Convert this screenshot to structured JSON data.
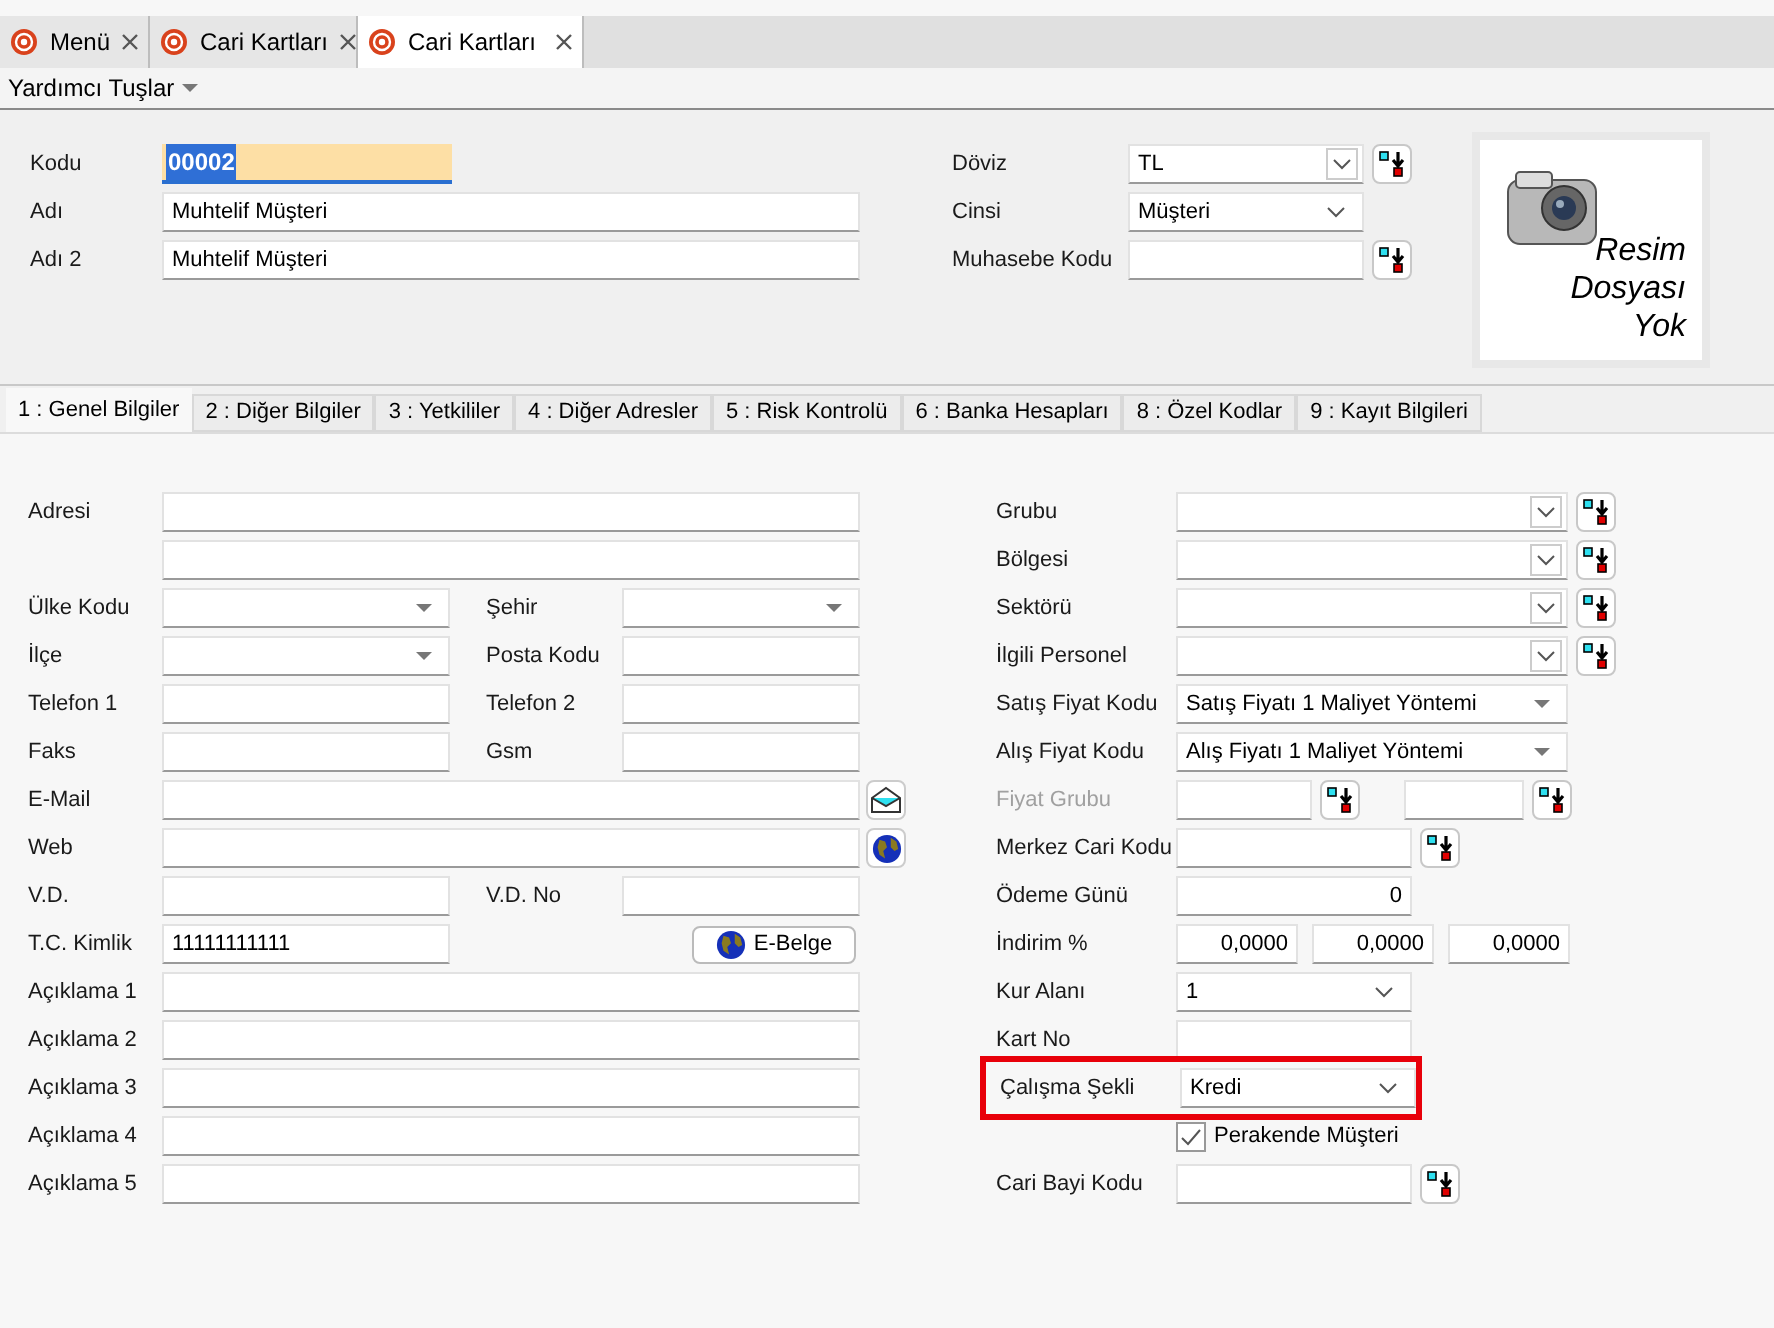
{
  "tabs": [
    {
      "label": "Menü",
      "selected": false
    },
    {
      "label": "Cari Kartları",
      "selected": false
    },
    {
      "label": "Cari Kartları",
      "selected": true
    }
  ],
  "toolbar": {
    "label": "Yardımcı Tuşlar"
  },
  "header": {
    "left": [
      {
        "label": "Kodu",
        "value": "00002",
        "kind": "code"
      },
      {
        "label": "Adı",
        "value": "Muhtelif Müşteri",
        "kind": "text"
      },
      {
        "label": "Adı 2",
        "value": "Muhtelif Müşteri",
        "kind": "text"
      }
    ],
    "right": [
      {
        "label": "Döviz",
        "value": "TL",
        "kind": "dropdown_lookup"
      },
      {
        "label": "Cinsi",
        "value": "Müşteri",
        "kind": "dropdown"
      },
      {
        "label": "Muhasebe Kodu",
        "kind": "text_lookup"
      }
    ],
    "image_placeholder": [
      "Resim",
      "Dosyası",
      "Yok"
    ]
  },
  "section_tabs": [
    {
      "label": "1 : Genel Bilgiler",
      "selected": true
    },
    {
      "label": "2 : Diğer Bilgiler",
      "selected": false
    },
    {
      "label": "3 : Yetkililer",
      "selected": false
    },
    {
      "label": "4 : Diğer Adresler",
      "selected": false
    },
    {
      "label": "5 : Risk Kontrolü",
      "selected": false
    },
    {
      "label": "6 : Banka Hesapları",
      "selected": false
    },
    {
      "label": "8 : Özel Kodlar",
      "selected": false
    },
    {
      "label": "9 : Kayıt Bilgileri",
      "selected": false
    }
  ],
  "left_rows": [
    {
      "kind": "full",
      "label": "Adresi"
    },
    {
      "kind": "full"
    },
    {
      "kind": "pair",
      "fields": [
        {
          "label": "Ülke Kodu",
          "kind": "combo"
        },
        {
          "label": "Şehir",
          "kind": "combo"
        }
      ]
    },
    {
      "kind": "pair",
      "fields": [
        {
          "label": "İlçe",
          "kind": "combo"
        },
        {
          "label": "Posta Kodu",
          "kind": "text"
        }
      ]
    },
    {
      "kind": "pair",
      "fields": [
        {
          "label": "Telefon 1",
          "kind": "text"
        },
        {
          "label": "Telefon 2",
          "kind": "text"
        }
      ]
    },
    {
      "kind": "pair",
      "fields": [
        {
          "label": "Faks",
          "kind": "text"
        },
        {
          "label": "Gsm",
          "kind": "text"
        }
      ]
    },
    {
      "kind": "mail",
      "label": "E-Mail"
    },
    {
      "kind": "web",
      "label": "Web"
    },
    {
      "kind": "pair",
      "fields": [
        {
          "label": "V.D.",
          "kind": "text"
        },
        {
          "label": "V.D. No",
          "kind": "text"
        }
      ]
    },
    {
      "kind": "button",
      "label": "T.C. Kimlik",
      "value": "11111111111",
      "button": "E-Belge"
    },
    {
      "kind": "full",
      "label": "Açıklama 1"
    },
    {
      "kind": "full",
      "label": "Açıklama 2"
    },
    {
      "kind": "full",
      "label": "Açıklama 3"
    },
    {
      "kind": "full",
      "label": "Açıklama 4"
    },
    {
      "kind": "full",
      "label": "Açıklama 5"
    }
  ],
  "right_rows": [
    {
      "kind": "lookup_combo",
      "label": "Grubu",
      "disabled": false,
      "highlighted": false
    },
    {
      "kind": "lookup_combo",
      "label": "Bölgesi",
      "disabled": false,
      "highlighted": false
    },
    {
      "kind": "lookup_combo",
      "label": "Sektörü",
      "disabled": false,
      "highlighted": false
    },
    {
      "kind": "lookup_combo",
      "label": "İlgili Personel",
      "disabled": false,
      "highlighted": false
    },
    {
      "kind": "select",
      "label": "Satış Fiyat Kodu",
      "values": [
        "Satış Fiyatı 1 Maliyet Yöntemi"
      ],
      "disabled": false,
      "highlighted": false
    },
    {
      "kind": "select",
      "label": "Alış Fiyat Kodu",
      "values": [
        "Alış  Fiyatı 1 Maliyet Yöntemi"
      ],
      "disabled": false,
      "highlighted": false
    },
    {
      "kind": "double_lookup",
      "label": "Fiyat Grubu",
      "disabled": true,
      "highlighted": false
    },
    {
      "kind": "short_lookup",
      "label": "Merkez Cari Kodu",
      "disabled": false,
      "highlighted": false
    },
    {
      "kind": "number",
      "label": "Ödeme Günü",
      "values": [
        "0"
      ],
      "disabled": false,
      "highlighted": false
    },
    {
      "kind": "triple",
      "label": "İndirim %",
      "values": [
        "0,0000",
        "0,0000",
        "0,0000"
      ],
      "disabled": false,
      "highlighted": false
    },
    {
      "kind": "dropdown",
      "label": "Kur Alanı",
      "values": [
        "1"
      ],
      "disabled": false,
      "highlighted": false
    },
    {
      "kind": "text",
      "label": "Kart No",
      "disabled": false,
      "highlighted": false
    },
    {
      "kind": "dropdown",
      "label": "Çalışma Şekli",
      "values": [
        "Kredi"
      ],
      "disabled": false,
      "highlighted": true
    },
    {
      "kind": "checkbox",
      "label": "Perakende Müşteri",
      "checked": true,
      "disabled": false,
      "highlighted": false
    },
    {
      "kind": "short_lookup",
      "label": "Cari Bayi Kodu",
      "disabled": false,
      "highlighted": false
    }
  ]
}
